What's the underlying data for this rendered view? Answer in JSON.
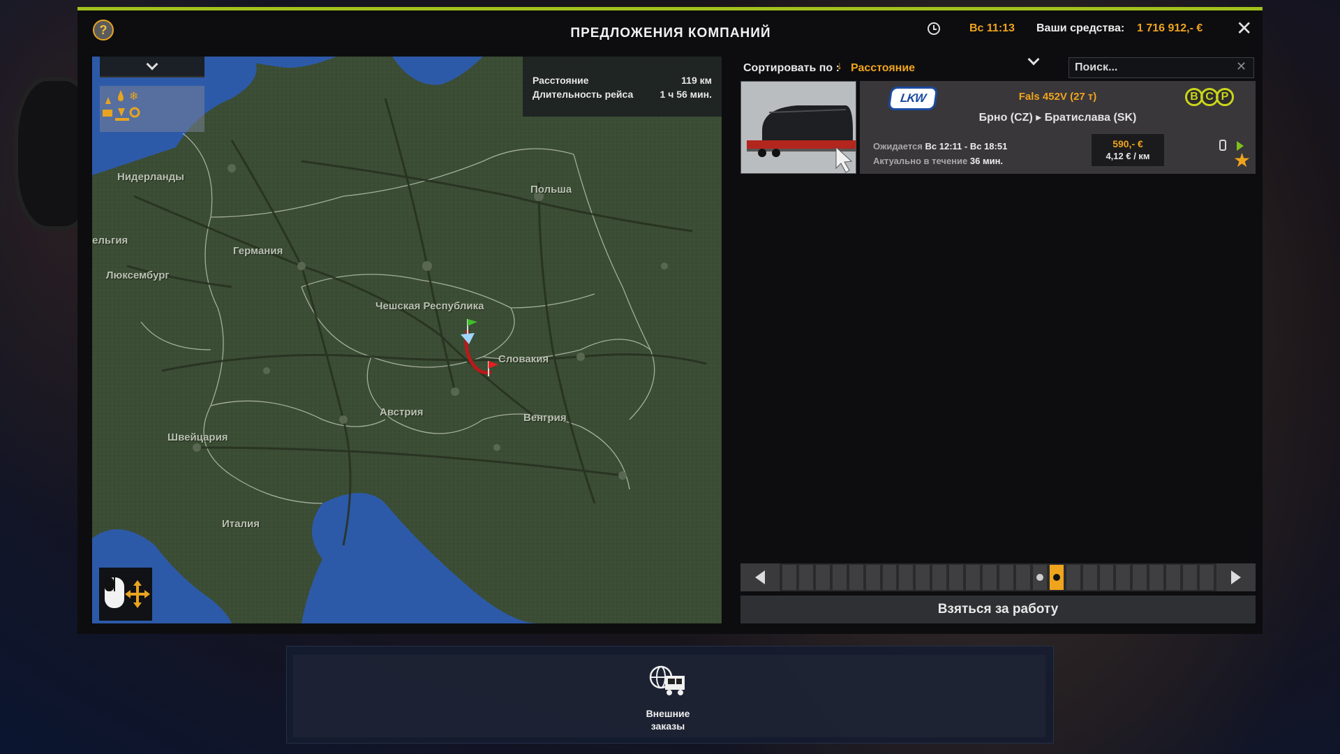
{
  "header": {
    "title": "ПРЕДЛОЖЕНИЯ КОМПАНИЙ",
    "help_label": "?",
    "time": "Вс 11:13",
    "funds_label": "Ваши средства:",
    "funds_value": "1 716 912,- €",
    "close_label": "✕"
  },
  "map": {
    "labels": [
      {
        "text": "Нидерланды"
      },
      {
        "text": "ельгия"
      },
      {
        "text": "Германия"
      },
      {
        "text": "Люксембург"
      },
      {
        "text": "Польша"
      },
      {
        "text": "Чешская Республика"
      },
      {
        "text": "Словакия"
      },
      {
        "text": "Австрия"
      },
      {
        "text": "Венгрия"
      },
      {
        "text": "Швейцария"
      },
      {
        "text": "Италия"
      }
    ],
    "route_info": {
      "distance_label": "Расстояние",
      "distance_value": "119 км",
      "duration_label": "Длительность рейса",
      "duration_value": "1 ч 56 мин."
    },
    "colors": {
      "land": "#3b4d34",
      "sea": "#2d5aa8",
      "route": "#c41e1e"
    }
  },
  "sort": {
    "label": "Сортировать по :",
    "value": "Расстояние"
  },
  "search": {
    "placeholder": "Поиск..."
  },
  "job": {
    "company": "LKW",
    "cargo": "Fals 452V (27 т)",
    "route": "Брно (CZ) ▸ Братислава (SK)",
    "adr": [
      "B",
      "C",
      "P"
    ],
    "expected_label": "Ожидается",
    "expected_value": "Вс 12:11 - Вс 18:51",
    "valid_label": "Актуально в течение",
    "valid_value": "36 мин.",
    "price": "590,- €",
    "per_km": "4,12 € / км"
  },
  "pager": {
    "total": 26,
    "marked_index": 15,
    "active_index": 16
  },
  "actions": {
    "take_job": "Взяться за работу",
    "external_orders": "Внешние заказы"
  },
  "colors": {
    "accent": "#f0a41d",
    "top_bar": "#a2c11c",
    "adr": "#c9d51a"
  }
}
